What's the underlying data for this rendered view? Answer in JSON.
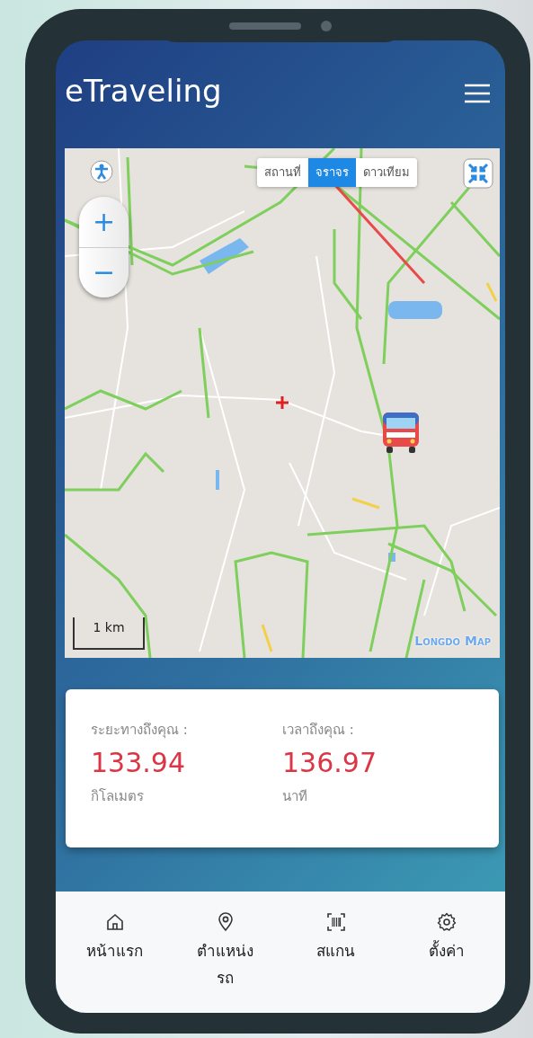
{
  "app": {
    "title": "eTraveling"
  },
  "map": {
    "layers": [
      {
        "label": "สถานที่",
        "selected": false
      },
      {
        "label": "จราจร",
        "selected": true
      },
      {
        "label": "ดาวเทียม",
        "selected": false
      }
    ],
    "zoom_in": "+",
    "zoom_out": "−",
    "scale": "1 km",
    "attribution": "Longdo Map"
  },
  "info": [
    {
      "label": "ระยะทางถึงคุณ :",
      "value": "133.94",
      "unit": "กิโลเมตร"
    },
    {
      "label": "เวลาถึงคุณ :",
      "value": "136.97",
      "unit": "นาที"
    }
  ],
  "nav": [
    {
      "kind": "home",
      "label": "หน้าแรก"
    },
    {
      "kind": "location",
      "label": "ตำแหน่งรถ"
    },
    {
      "kind": "scan",
      "label": "สแกน"
    },
    {
      "kind": "settings",
      "label": "ตั้งค่า"
    }
  ]
}
